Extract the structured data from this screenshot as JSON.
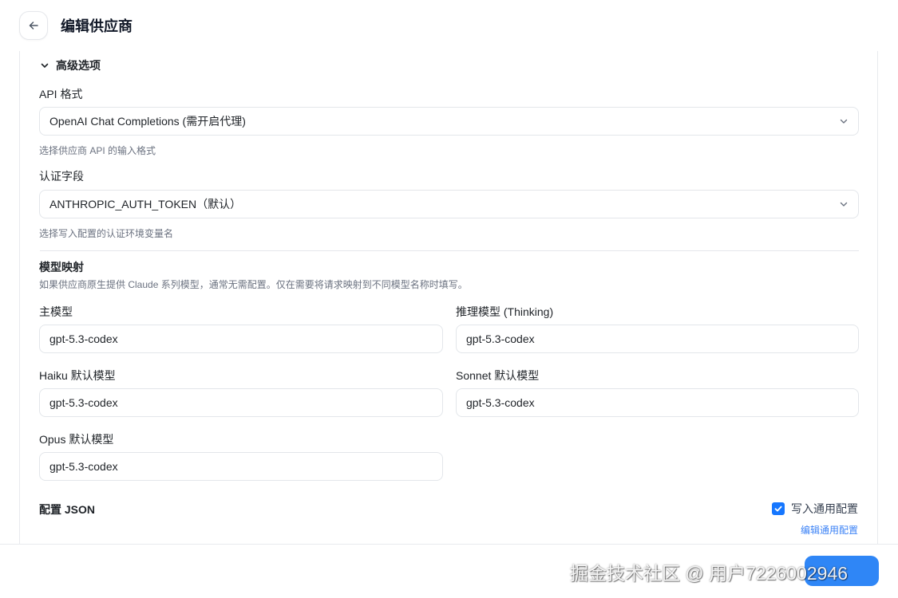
{
  "header": {
    "title": "编辑供应商",
    "back_icon": "arrow-left-icon"
  },
  "advanced": {
    "toggle_label": "高级选项",
    "api_format": {
      "label": "API 格式",
      "value": "OpenAI Chat Completions (需开启代理)",
      "hint": "选择供应商 API 的输入格式"
    },
    "auth_field": {
      "label": "认证字段",
      "value": "ANTHROPIC_AUTH_TOKEN（默认）",
      "hint": "选择写入配置的认证环境变量名"
    }
  },
  "model_mapping": {
    "title": "模型映射",
    "description": "如果供应商原生提供 Claude 系列模型，通常无需配置。仅在需要将请求映射到不同模型名称时填写。",
    "fields": {
      "main": {
        "label": "主模型",
        "value": "gpt-5.3-codex"
      },
      "thinking": {
        "label": "推理模型 (Thinking)",
        "value": "gpt-5.3-codex"
      },
      "haiku": {
        "label": "Haiku 默认模型",
        "value": "gpt-5.3-codex"
      },
      "sonnet": {
        "label": "Sonnet 默认模型",
        "value": "gpt-5.3-codex"
      },
      "opus": {
        "label": "Opus 默认模型",
        "value": "gpt-5.3-codex"
      }
    }
  },
  "config_json": {
    "label": "配置 JSON",
    "write_common_label": "写入通用配置",
    "write_common_checked": true,
    "edit_common_link": "编辑通用配置"
  },
  "footer": {
    "watermark": "掘金技术社区 @ 用户7226002946"
  },
  "colors": {
    "accent": "#2f86f6",
    "checkbox": "#1677ff",
    "link": "#3b82f6"
  }
}
